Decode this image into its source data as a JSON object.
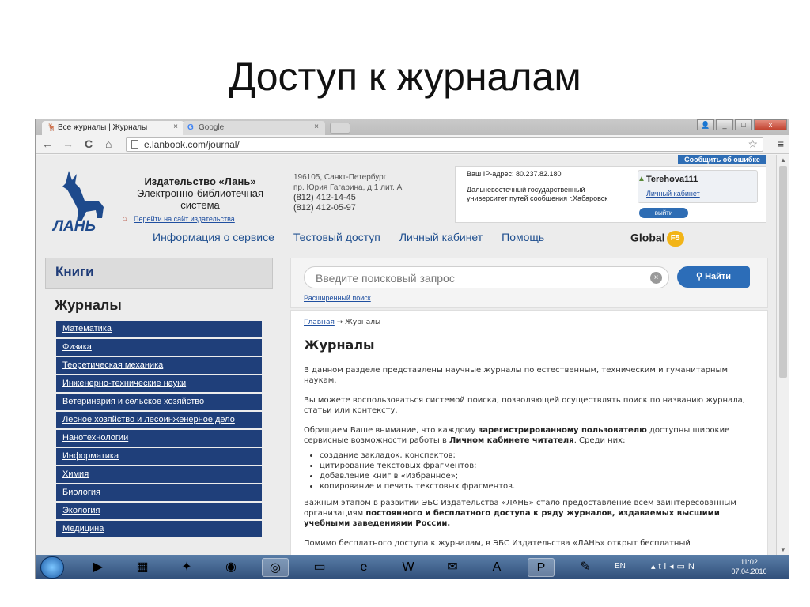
{
  "slide": {
    "title": "Доступ к журналам"
  },
  "browser": {
    "tabs": [
      {
        "label": "Все журналы | Журналы",
        "close": "×"
      },
      {
        "label": "Google",
        "close": "×"
      }
    ],
    "url": "e.lanbook.com/journal/",
    "nav": {
      "back": "←",
      "forward": "→",
      "reload": "C",
      "home": "⌂",
      "star": "☆",
      "menu": "≡"
    },
    "window": {
      "min": "_",
      "max": "□",
      "close": "x"
    }
  },
  "header": {
    "report_error": "Сообщить об ошибке",
    "logo_text": "ЛАНЬ",
    "publisher_name": "Издательство «Лань»",
    "publisher_sub": "Электронно-библиотечная система",
    "publisher_link": "Перейти на сайт издательства",
    "address_line1": "196105, Санкт-Петербург",
    "address_line2": "пр. Юрия Гагарина, д.1 лит. А",
    "phone1": "(812) 412-14-45",
    "phone2": "(812) 412-05-97",
    "ip_label": "Ваш IP-адрес: 80.237.82.180",
    "org_name": "Дальневосточный государственный университет путей сообщения г.Хабаровск",
    "username": "Terehova111",
    "cabinet_link": "Личный кабинет",
    "logout_label": "выйти"
  },
  "mainnav": [
    "Информация о сервисе",
    "Тестовый доступ",
    "Личный кабинет",
    "Помощь"
  ],
  "global": {
    "label": "Global",
    "badge": "F5"
  },
  "sidebar": {
    "books": "Книги",
    "journals": "Журналы",
    "categories": [
      "Математика",
      "Физика",
      "Теоретическая механика",
      "Инженерно-технические науки",
      "Ветеринария и сельское хозяйство",
      "Лесное хозяйство и лесоинженерное дело",
      "Нанотехнологии",
      "Информатика",
      "Химия",
      "Биология",
      "Экология",
      "Медицина"
    ]
  },
  "search": {
    "placeholder": "Введите поисковый запрос",
    "button": "Найти",
    "advanced": "Расширенный поиск"
  },
  "content": {
    "breadcrumb_home": "Главная",
    "breadcrumb_sep": "→",
    "breadcrumb_current": "Журналы",
    "title": "Журналы",
    "p1": "В данном разделе представлены научные журналы по естественным, техническим и гуманитарным наукам.",
    "p2": "Вы можете воспользоваться системой поиска, позволяющей осуществлять поиск по названию журнала, статьи или контексту.",
    "p3_a": "Обращаем Ваше внимание, что каждому ",
    "p3_b": "зарегистрированному пользователю",
    "p3_c": " доступны широкие сервисные возможности работы в ",
    "p3_d": "Личном кабинете читателя",
    "p3_e": ". Среди них:",
    "list": [
      "создание закладок, конспектов;",
      "цитирование текстовых фрагментов;",
      "добавление книг в «Избранное»;",
      "копирование и печать текстовых фрагментов."
    ],
    "p4_a": "Важным этапом в развитии ЭБС Издательства «ЛАНЬ» стало предоставление всем заинтересованным организациям ",
    "p4_b": "постоянного и бесплатного доступа к ряду журналов, издаваемых высшими учебными заведениями России.",
    "p5": "Помимо бесплатного доступа к журналам, в ЭБС Издательства «ЛАНЬ» открыт бесплатный"
  },
  "taskbar": {
    "lang": "EN",
    "time": "11:02",
    "date": "07.04.2016"
  }
}
